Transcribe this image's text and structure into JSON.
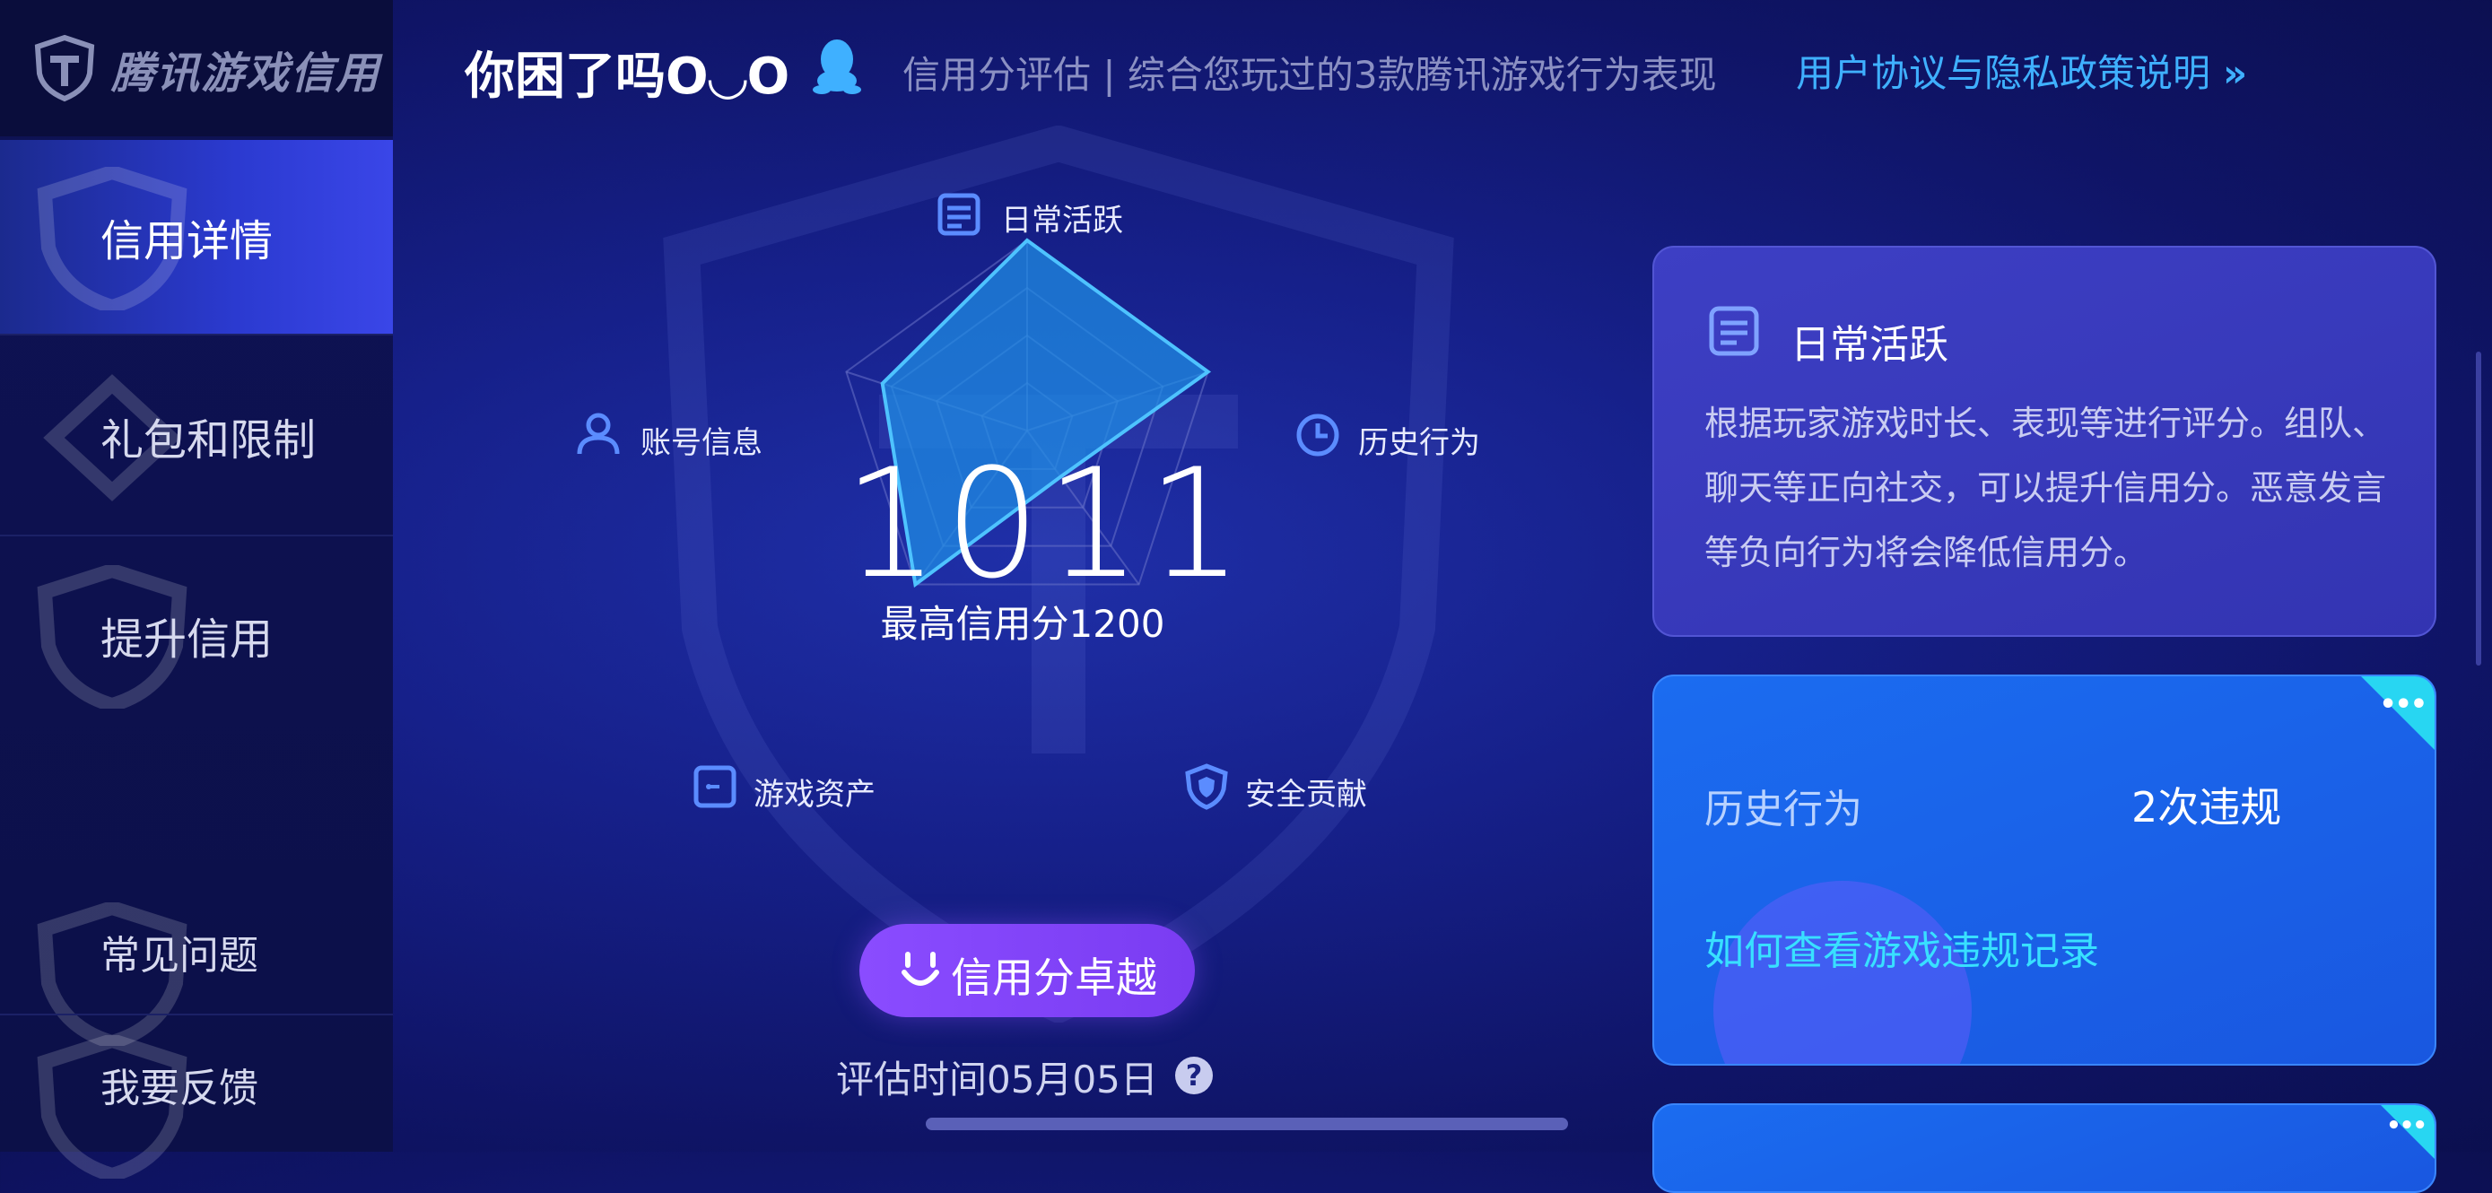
{
  "app": {
    "logo_text": "腾讯游戏信用"
  },
  "sidebar": {
    "items": [
      {
        "label": "信用详情",
        "active": true
      },
      {
        "label": "礼包和限制",
        "active": false
      },
      {
        "label": "提升信用",
        "active": false
      },
      {
        "label": "常见问题",
        "active": false
      },
      {
        "label": "我要反馈",
        "active": false
      }
    ]
  },
  "header": {
    "user_name": "你困了吗O◡O",
    "description": "信用分评估 | 综合您玩过的3款腾讯游戏行为表现",
    "link_text": "用户协议与隐私政策说明",
    "link_chevron": "»"
  },
  "radar": {
    "axes": [
      {
        "label": "日常活跃",
        "icon": "calendar-icon"
      },
      {
        "label": "历史行为",
        "icon": "clock-icon"
      },
      {
        "label": "安全贡献",
        "icon": "shield-icon"
      },
      {
        "label": "游戏资产",
        "icon": "wallet-icon"
      },
      {
        "label": "账号信息",
        "icon": "user-icon"
      }
    ],
    "values": [
      1.0,
      1.0,
      0.3,
      1.0,
      0.8
    ]
  },
  "score": {
    "value": "1011",
    "max_text": "最高信用分1200"
  },
  "level_button": {
    "label": "信用分卓越"
  },
  "eval_time": {
    "text": "评估时间05月05日",
    "help": "?"
  },
  "cards": {
    "daily": {
      "title": "日常活跃",
      "body": "根据玩家游戏时长、表现等进行评分。组队、聊天等正向社交，可以提升信用分。恶意发言等负向行为将会降低信用分。"
    },
    "history": {
      "label": "历史行为",
      "value": "2次违规",
      "link": "如何查看游戏违规记录",
      "more": "•••"
    },
    "next": {
      "more": "•••"
    }
  },
  "colors": {
    "accent": "#3fb0ff",
    "radar_fill": "#1f8fe6",
    "button": "#8a4cff",
    "card_blue": "#1b6cf0",
    "card_purple": "#3d3fc4"
  }
}
